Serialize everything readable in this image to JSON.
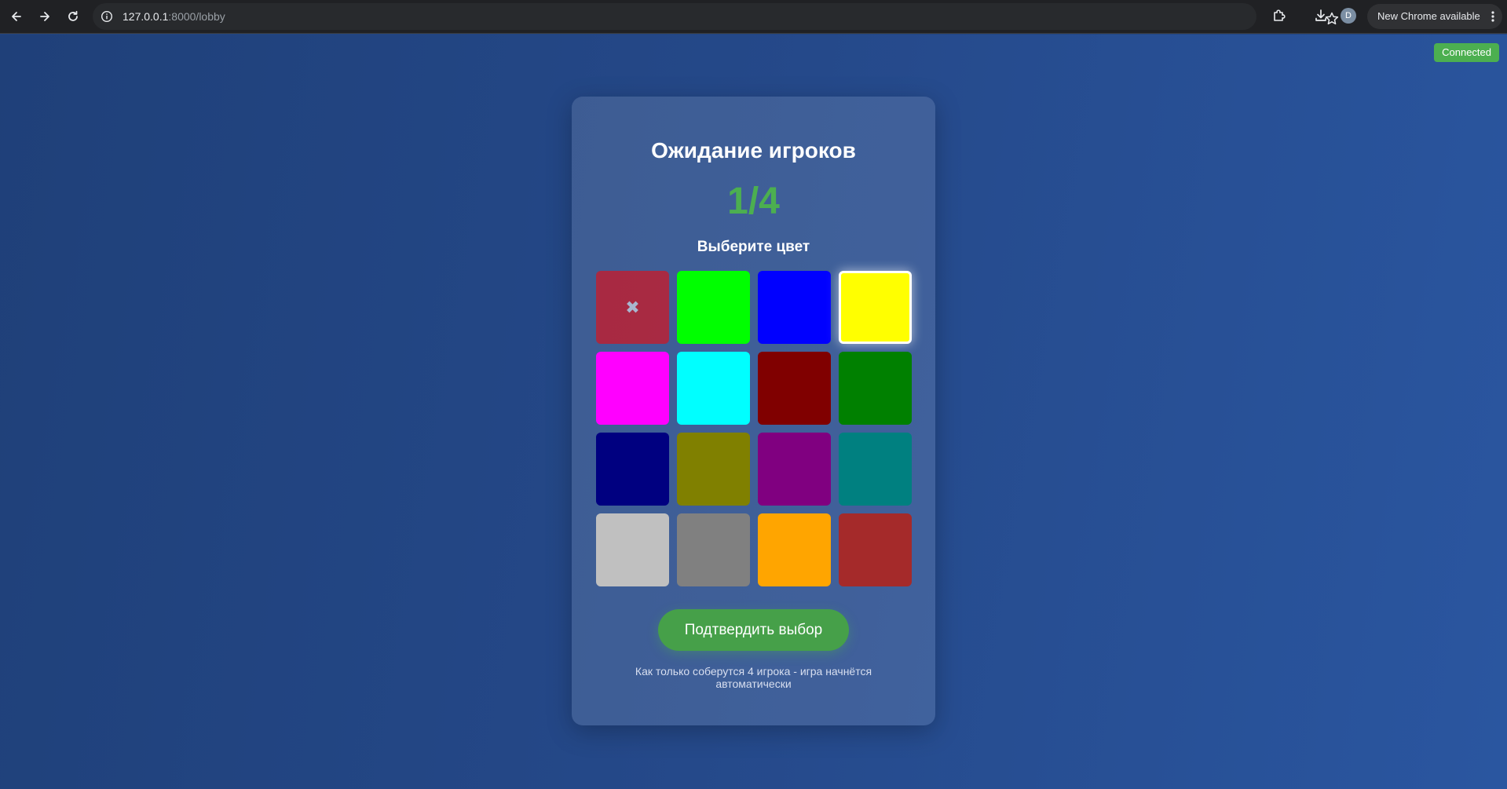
{
  "browser": {
    "url_host": "127.0.0.1",
    "url_path": ":8000/lobby",
    "profile_initial": "D",
    "update_label": "New Chrome available"
  },
  "status": {
    "label": "Connected",
    "color": "#4caf50"
  },
  "lobby": {
    "title": "Ожидание игроков",
    "player_count": "1/4",
    "players_joined": 1,
    "players_max": 4,
    "color_prompt": "Выберите цвет",
    "confirm_label": "Подтвердить выбор",
    "hint": "Как только соберутся 4 игрока - игра начнётся автоматически",
    "taken_mark": "✖",
    "colors": [
      {
        "name": "red",
        "hex": "#ff0000",
        "state": "taken"
      },
      {
        "name": "lime",
        "hex": "#00ff00",
        "state": "available"
      },
      {
        "name": "blue",
        "hex": "#0000ff",
        "state": "available"
      },
      {
        "name": "yellow",
        "hex": "#ffff00",
        "state": "selected"
      },
      {
        "name": "magenta",
        "hex": "#ff00ff",
        "state": "available"
      },
      {
        "name": "cyan",
        "hex": "#00ffff",
        "state": "available"
      },
      {
        "name": "maroon",
        "hex": "#800000",
        "state": "available"
      },
      {
        "name": "green",
        "hex": "#008000",
        "state": "available"
      },
      {
        "name": "navy",
        "hex": "#000080",
        "state": "available"
      },
      {
        "name": "olive",
        "hex": "#808000",
        "state": "available"
      },
      {
        "name": "purple",
        "hex": "#800080",
        "state": "available"
      },
      {
        "name": "teal",
        "hex": "#008080",
        "state": "available"
      },
      {
        "name": "silver",
        "hex": "#c0c0c0",
        "state": "available"
      },
      {
        "name": "gray",
        "hex": "#808080",
        "state": "available"
      },
      {
        "name": "orange",
        "hex": "#ffa500",
        "state": "available"
      },
      {
        "name": "brown",
        "hex": "#a52a2a",
        "state": "available"
      }
    ]
  },
  "icons": {
    "back": "back-arrow-icon",
    "forward": "forward-arrow-icon",
    "reload": "reload-icon",
    "site_info": "info-icon",
    "bookmark": "star-icon",
    "extensions": "puzzle-icon",
    "downloads": "download-icon",
    "menu": "more-vert-icon"
  }
}
